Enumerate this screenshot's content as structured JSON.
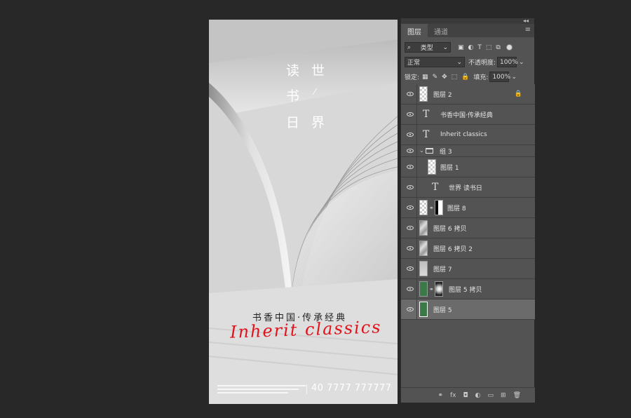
{
  "poster": {
    "title_chars": [
      "读",
      "世",
      "书",
      "⁄",
      "日",
      "界"
    ],
    "subtitle_cn": "书香中国·传承经典",
    "subtitle_en": "Inherit classics",
    "phone": "40 7777 777777"
  },
  "panel": {
    "collapse_glyph": "◂◂",
    "tabs": [
      "图层",
      "通道"
    ],
    "menu_glyph": "≡",
    "filter": {
      "search_glyph": "⌕",
      "kind_label": "类型",
      "chevron": "⌄"
    },
    "blend": {
      "mode": "正常",
      "opacity_label": "不透明度:",
      "opacity_value": "100%"
    },
    "lock": {
      "label": "锁定:",
      "fill_label": "填充:",
      "fill_value": "100%"
    },
    "layers": [
      {
        "name": "图层 2"
      },
      {
        "name": "书香中国·传承经典"
      },
      {
        "name": "Inherit classics"
      },
      {
        "name": "组 3"
      },
      {
        "name": "图层 1"
      },
      {
        "name": "世界 读书日"
      },
      {
        "name": "图层 8"
      },
      {
        "name": "图层 6 拷贝"
      },
      {
        "name": "图层 6 拷贝 2"
      },
      {
        "name": "图层 7"
      },
      {
        "name": "图层 5 拷贝"
      },
      {
        "name": "图层 5"
      }
    ],
    "bottom_glyphs": [
      "⚭",
      "fx",
      "◘",
      "◐",
      "▭",
      "⊞",
      "🗑"
    ]
  }
}
